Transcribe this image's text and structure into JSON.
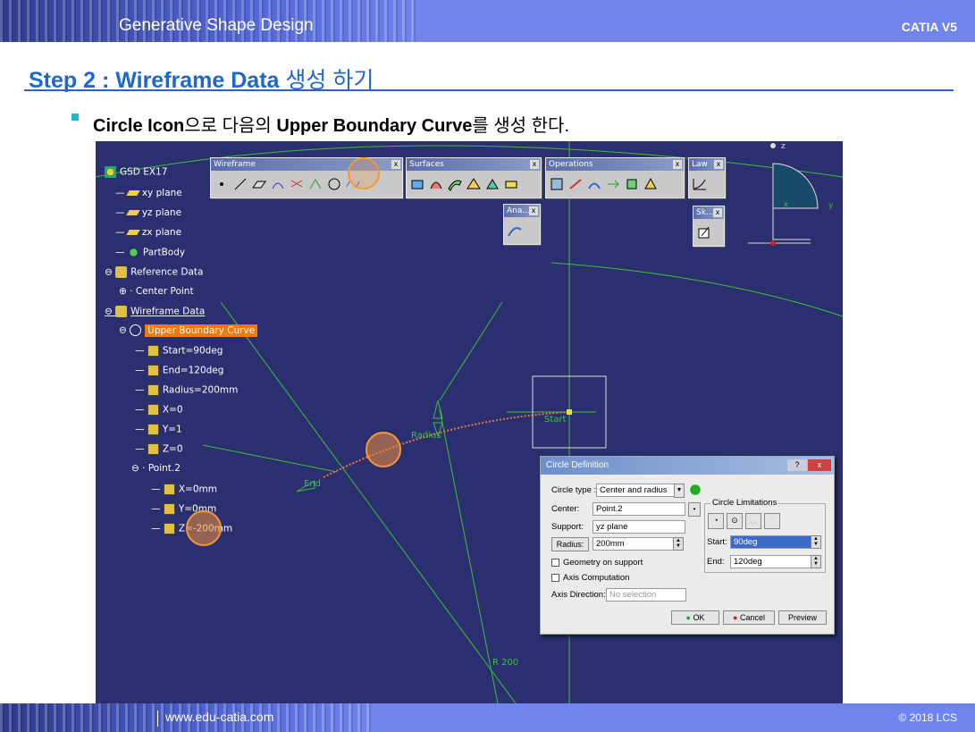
{
  "header": {
    "title": "Generative Shape Design",
    "right": "CATIA V5"
  },
  "footer": {
    "url": "www.edu-catia.com",
    "copyright": "© 2018 LCS"
  },
  "step": {
    "bold": "Step 2 : Wireframe Data",
    "rest": " 생성 하기"
  },
  "instruction": {
    "p1": "Circle Icon",
    "p2": "으로 다음의 ",
    "p3": "Upper Boundary Curve",
    "p4": "를 생성 한다."
  },
  "tree": {
    "root": "GSD EX17",
    "xy": "xy plane",
    "yz": "yz plane",
    "zx": "zx plane",
    "partbody": "PartBody",
    "refdata": "Reference Data",
    "centerpoint": "Center Point",
    "wireframe": "Wireframe Data",
    "curve": "Upper Boundary Curve",
    "start": "Start=90deg",
    "end": "End=120deg",
    "radius": "Radius=200mm",
    "x": "X=0",
    "y": "Y=1",
    "z": "Z=0",
    "point2": "Point.2",
    "px": "X=0mm",
    "py": "Y=0mm",
    "pz": "Z=-200mm"
  },
  "toolbars": {
    "wireframe": "Wireframe",
    "surfaces": "Surfaces",
    "operations": "Operations",
    "law": "Law",
    "analysis": "Ana...",
    "sketch": "Sk..."
  },
  "geometry": {
    "start": "Start",
    "end": "End",
    "radius": "Radius",
    "r200": "R 200",
    "z": "z",
    "y": "y",
    "x": "x"
  },
  "dialog": {
    "title": "Circle Definition",
    "circle_type_label": "Circle type :",
    "circle_type": "Center and radius",
    "center_label": "Center:",
    "center": "Point.2",
    "support_label": "Support:",
    "support": "yz plane",
    "radius_btn": "Radius:",
    "radius": "200mm",
    "geom_support": "Geometry on support",
    "axis_comp": "Axis Computation",
    "axis_dir_label": "Axis Direction:",
    "axis_dir_placeholder": "No selection",
    "limits_title": "Circle Limitations",
    "start_label": "Start:",
    "start": "90deg",
    "end_label": "End:",
    "end": "120deg",
    "ok": "OK",
    "cancel": "Cancel",
    "preview": "Preview"
  },
  "colors": {
    "background": "#2b2f6f",
    "curve": "#e87a3a",
    "geometry": "#3cc03c",
    "highlight": "#f29a36"
  }
}
